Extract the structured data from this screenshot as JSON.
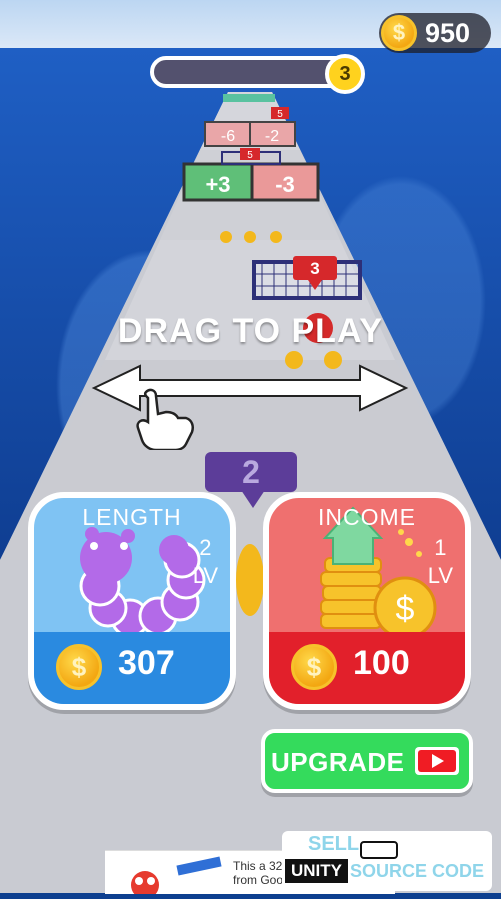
{
  "hud": {
    "coins": "950",
    "coin_symbol": "$",
    "level": "3"
  },
  "track": {
    "gate_labels": [
      "-6",
      "-2",
      "+3",
      "-3"
    ],
    "basket_counts": [
      "5",
      "5",
      "5",
      "3"
    ]
  },
  "instructions": {
    "title": "DRAG TO PLAY"
  },
  "bubble_value": "2",
  "cards": {
    "length": {
      "title": "LENGTH",
      "level_num": "2",
      "level_unit": "LV",
      "price": "307"
    },
    "income": {
      "title": "INCOME",
      "level_num": "1",
      "level_unit": "LV",
      "price": "100"
    }
  },
  "upgrade": {
    "label": "UPGRADE"
  },
  "ad": {
    "text_line1": "This a 32",
    "text_line2": "from Google AdMob."
  },
  "watermark": {
    "sell": "SELL",
    "unity": "UNITY",
    "source": "SOURCE CODE"
  },
  "colors": {
    "length_card": "#7fc3f3",
    "income_card": "#ef706f",
    "upgrade_button": "#34db5c",
    "bubble": "#5c3d99"
  }
}
